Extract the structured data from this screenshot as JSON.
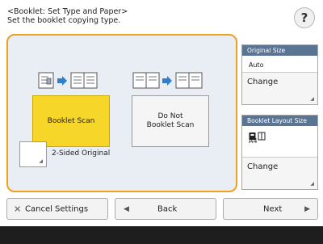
{
  "header": {
    "title_line1": "<Booklet: Set Type and Paper>",
    "title_line2": "Set the booklet copying type."
  },
  "help": {
    "label": "?"
  },
  "scan_options": [
    {
      "label_line1": "Booklet Scan",
      "label_line2": "",
      "selected": true
    },
    {
      "label_line1": "Do Not",
      "label_line2": "Booklet Scan",
      "selected": false
    }
  ],
  "two_sided": {
    "label": "2-Sided Original"
  },
  "original_size": {
    "header": "Original Size",
    "value": "Auto",
    "change_label": "Change"
  },
  "booklet_layout": {
    "header": "Booklet Layout Size",
    "value": "A4",
    "change_label": "Change"
  },
  "bottom": {
    "cancel_label": "Cancel Settings",
    "back_label": "Back",
    "next_label": "Next"
  },
  "colors": {
    "accent_orange": "#f0a020",
    "selected_yellow": "#f7d62a",
    "card_header_blue": "#5a7594",
    "icon_blue": "#2d7fd0"
  }
}
